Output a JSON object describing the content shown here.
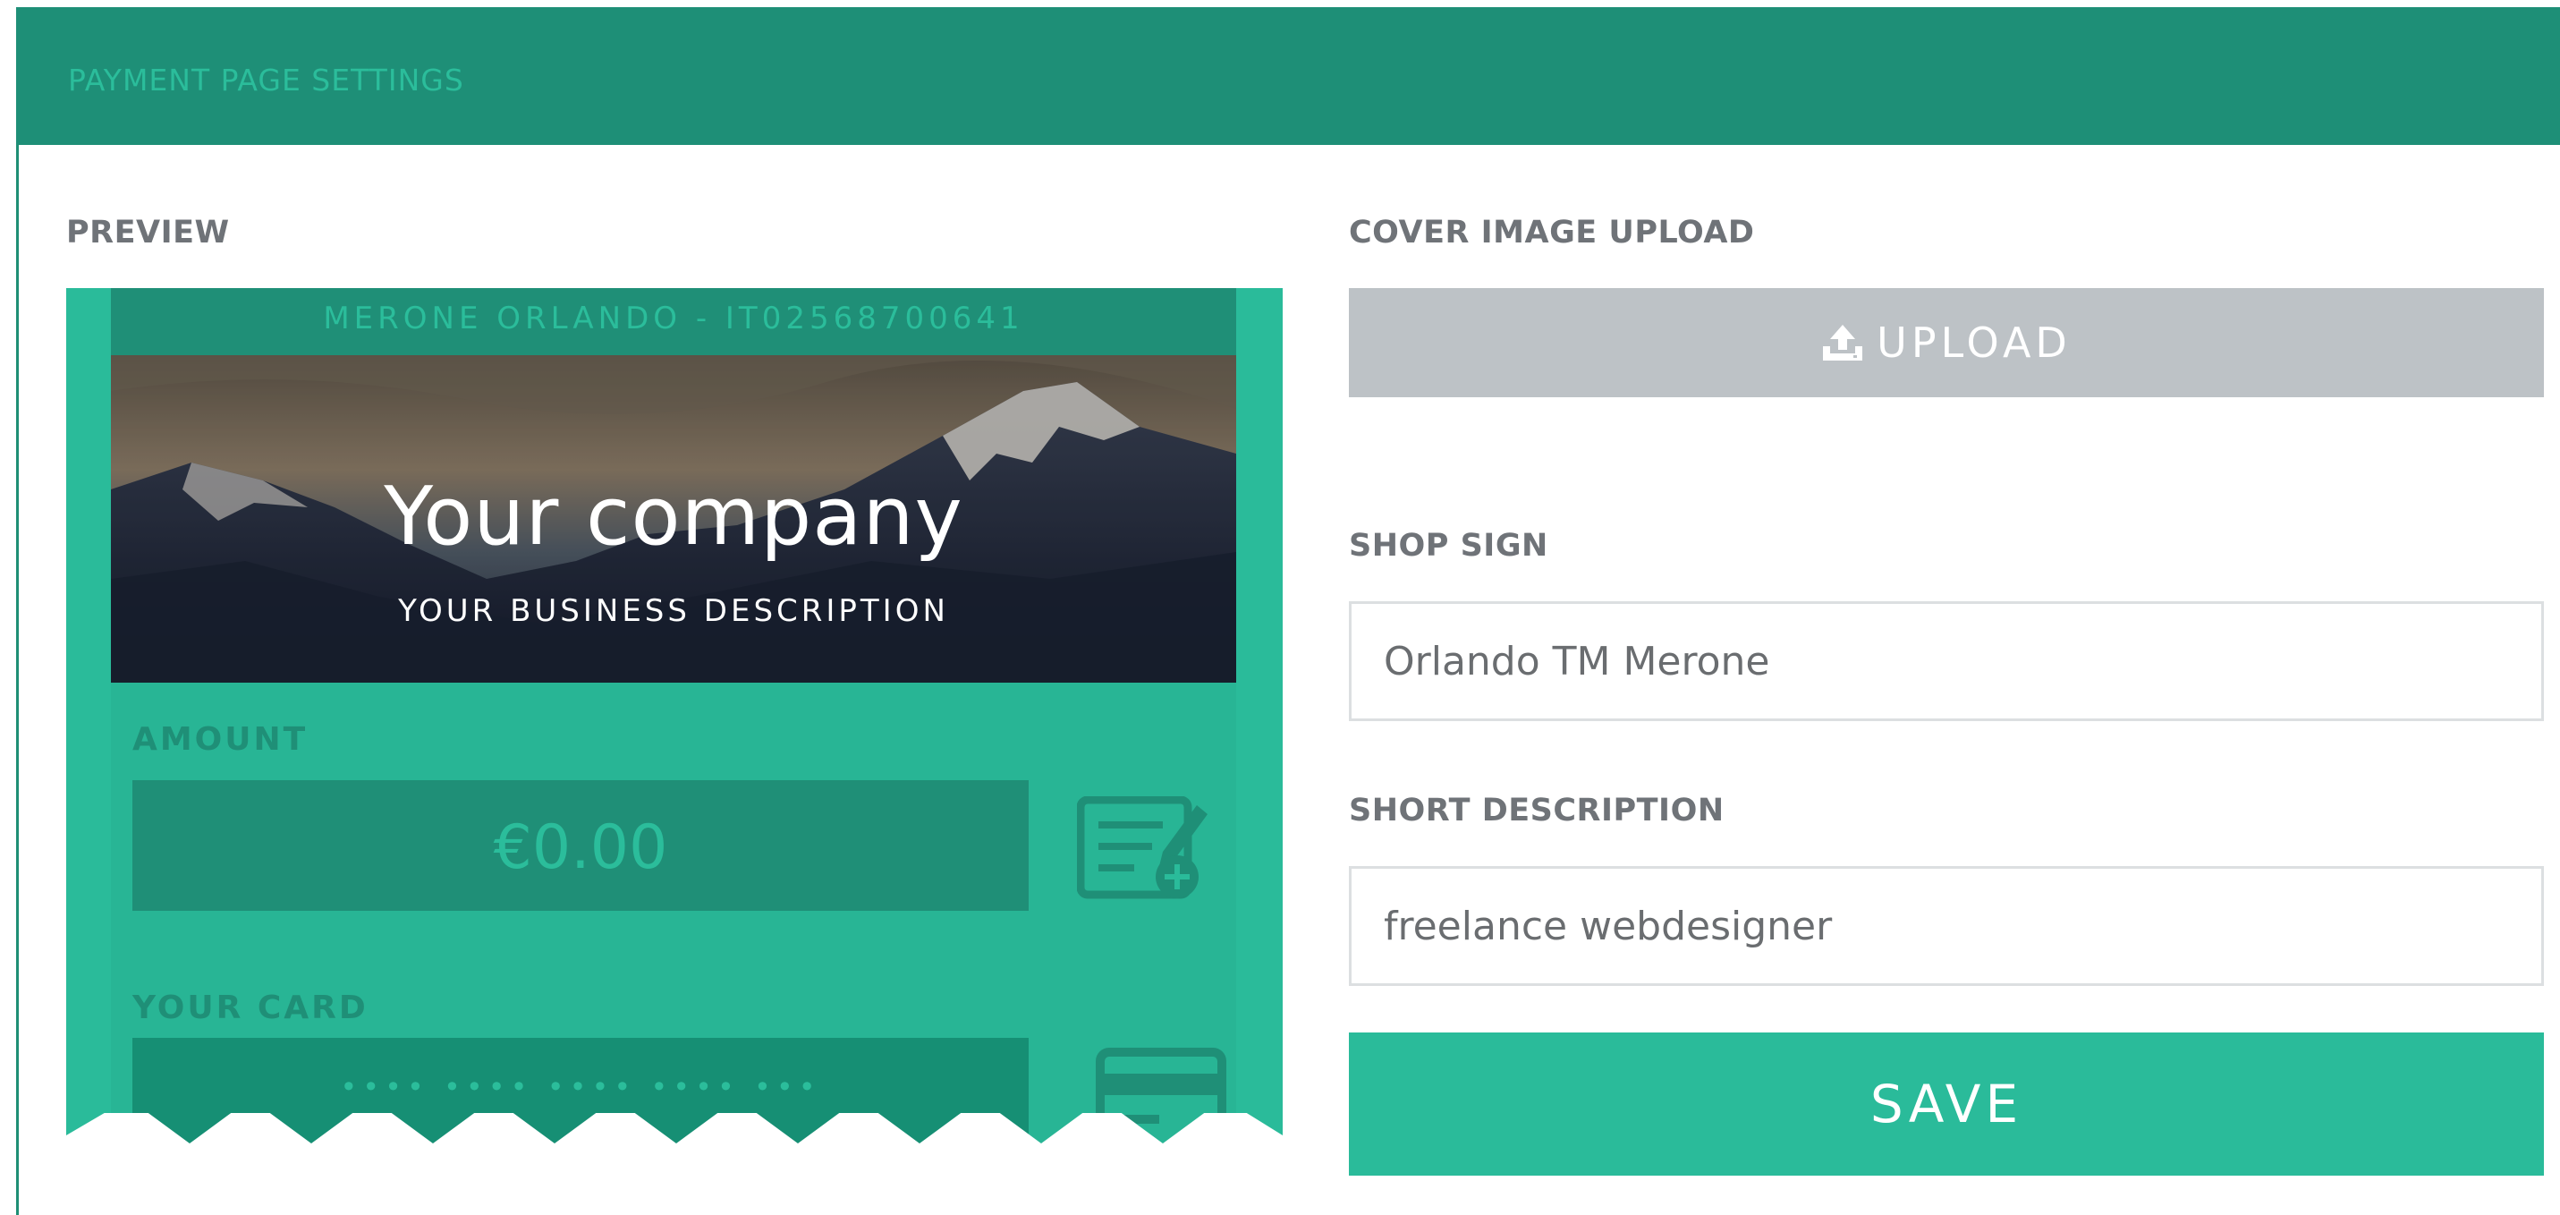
{
  "header": {
    "title": "PAYMENT PAGE SETTINGS"
  },
  "preview": {
    "label": "PREVIEW",
    "merchant": "MERONE ORLANDO - IT02568700641",
    "company": "Your company",
    "business_description": "YOUR BUSINESS DESCRIPTION",
    "amount_label": "AMOUNT",
    "amount_value": "€0.00",
    "card_label": "YOUR CARD",
    "card_placeholder": "•••• •••• •••• •••• •••",
    "icons": [
      "edit-note-icon",
      "credit-card-icon"
    ]
  },
  "cover_upload": {
    "label": "COVER IMAGE UPLOAD",
    "button_label": "UPLOAD",
    "icon": "upload-icon"
  },
  "shop_sign": {
    "label": "SHOP SIGN",
    "value": "Orlando TM Merone"
  },
  "short_description": {
    "label": "SHORT DESCRIPTION",
    "value": "freelance webdesigner"
  },
  "save_label": "SAVE",
  "colors": {
    "header": "#1e8f77",
    "accent": "#2abb9a",
    "dark_accent": "#1f8f77",
    "upload_button": "#bdc2c6",
    "label_text": "#6f7378"
  }
}
